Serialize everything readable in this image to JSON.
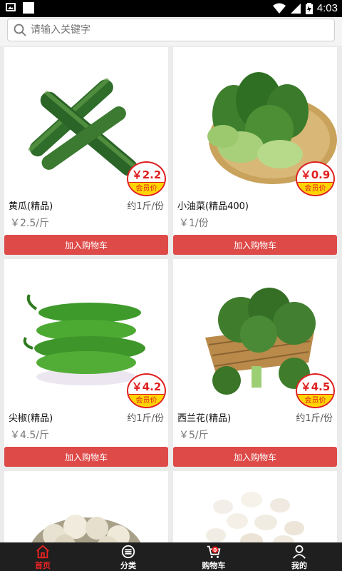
{
  "status_bar": {
    "time": "4:03"
  },
  "search": {
    "placeholder": "请输入关键字"
  },
  "products": [
    {
      "name": "黄瓜(精品)",
      "spec": "约1斤/份",
      "unit_price": "￥2.5/斤",
      "member_price": "￥2.2",
      "member_label": "会员价",
      "button": "加入购物车",
      "image": "cucumber"
    },
    {
      "name": "小油菜(精品400)",
      "spec": "",
      "unit_price": "￥1/份",
      "member_price": "￥0.9",
      "member_label": "会员价",
      "button": "加入购物车",
      "image": "bok-choy"
    },
    {
      "name": "尖椒(精品)",
      "spec": "约1斤/份",
      "unit_price": "￥4.5/斤",
      "member_price": "￥4.2",
      "member_label": "会员价",
      "button": "加入购物车",
      "image": "green-pepper"
    },
    {
      "name": "西兰花(精品)",
      "spec": "约1斤/份",
      "unit_price": "￥5/斤",
      "member_price": "￥4.5",
      "member_label": "会员价",
      "button": "加入购物车",
      "image": "broccoli"
    }
  ],
  "partial_products": [
    {
      "image": "garlic"
    },
    {
      "image": "mushroom"
    }
  ],
  "tabbar": {
    "tabs": [
      {
        "label": "首页",
        "icon": "home-icon",
        "active": true
      },
      {
        "label": "分类",
        "icon": "menu-icon",
        "active": false
      },
      {
        "label": "购物车",
        "icon": "cart-icon",
        "badge": "0",
        "active": false
      },
      {
        "label": "我的",
        "icon": "user-icon",
        "active": false
      }
    ]
  },
  "colors": {
    "accent": "#dd4a48",
    "badge_yellow": "#ffd500",
    "price_red": "#e02020",
    "tabbar_bg": "#1f1f1f"
  }
}
